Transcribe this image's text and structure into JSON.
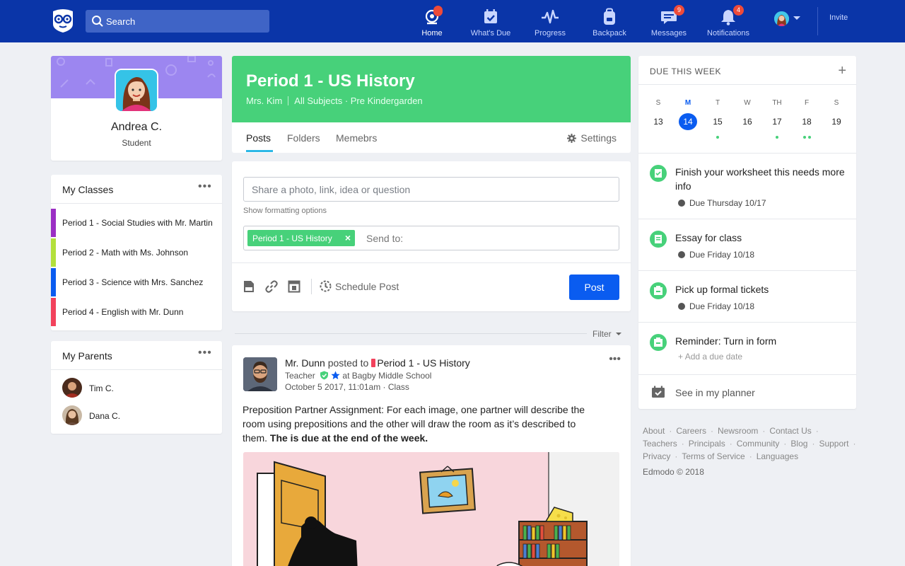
{
  "search": {
    "placeholder": "Search"
  },
  "nav": [
    {
      "label": "Home",
      "icon": "home-icon",
      "badge": ""
    },
    {
      "label": "What's Due",
      "icon": "calendar-check-icon",
      "badge": ""
    },
    {
      "label": "Progress",
      "icon": "pulse-icon",
      "badge": ""
    },
    {
      "label": "Backpack",
      "icon": "backpack-icon",
      "badge": ""
    },
    {
      "label": "Messages",
      "icon": "chat-icon",
      "badge": "9"
    },
    {
      "label": "Notifications",
      "icon": "bell-icon",
      "badge": "4"
    }
  ],
  "topbar": {
    "invite": "Invite"
  },
  "profile": {
    "name": "Andrea C.",
    "role": "Student"
  },
  "classes": {
    "title": "My Classes",
    "items": [
      {
        "label": "Period 1 - Social Studies with Mr. Martin",
        "color": "#9b2fc4"
      },
      {
        "label": "Period 2 - Math with Ms. Johnson",
        "color": "#b3e03c"
      },
      {
        "label": "Period 3 - Science with Mrs. Sanchez",
        "color": "#0a5cf0"
      },
      {
        "label": "Period 4 - English with Mr. Dunn",
        "color": "#f2425c"
      }
    ]
  },
  "parents": {
    "title": "My Parents",
    "items": [
      {
        "name": "Tim C."
      },
      {
        "name": "Dana C."
      }
    ]
  },
  "group": {
    "title": "Period 1 - US History",
    "teacher": "Mrs. Kim",
    "subjects": "All Subjects · Pre Kindergarden",
    "tabs": [
      "Posts",
      "Folders",
      "Memebrs"
    ],
    "settings": "Settings",
    "color": "#47d17a"
  },
  "composer": {
    "placeholder": "Share a photo, link, idea or question",
    "format_link": "Show formatting options",
    "chip": "Period 1 - US History",
    "send_to": "Send to:",
    "schedule": "Schedule Post",
    "post_button": "Post"
  },
  "filter": {
    "label": "Filter"
  },
  "post": {
    "author": "Mr. Dunn",
    "posted_to": "posted to",
    "group": "Period 1 - US History",
    "role": "Teacher",
    "school": "at Bagby Middle School",
    "timestamp": "October 5 2017, 11:01am · Class",
    "body": "Preposition Partner Assignment: For each image, one partner will describe the room using prepositions and the other will draw the room as it’s described to them.",
    "body_bold": "The is due at the end of the week."
  },
  "due_week": {
    "title": "DUE THIS WEEK",
    "days": [
      {
        "letter": "S",
        "num": "13",
        "dots": 0
      },
      {
        "letter": "M",
        "num": "14",
        "dots": 0,
        "today": true
      },
      {
        "letter": "T",
        "num": "15",
        "dots": 1
      },
      {
        "letter": "W",
        "num": "16",
        "dots": 0
      },
      {
        "letter": "TH",
        "num": "17",
        "dots": 1
      },
      {
        "letter": "F",
        "num": "18",
        "dots": 2
      },
      {
        "letter": "S",
        "num": "19",
        "dots": 0
      }
    ],
    "items": [
      {
        "name": "Finish your worksheet this needs more info",
        "date": "Due Thursday 10/17"
      },
      {
        "name": "Essay for class",
        "date": "Due Friday 10/18"
      },
      {
        "name": "Pick up formal tickets",
        "date": "Due Friday 10/18"
      },
      {
        "name": "Reminder: Turn in form",
        "add": "Add a due date"
      }
    ],
    "planner": "See in my planner"
  },
  "footer": {
    "links": [
      "About",
      "Careers",
      "Newsroom",
      "Contact Us",
      "Teachers",
      "Principals",
      "Community",
      "Blog",
      "Support",
      "Privacy",
      "Terms of Service",
      "Languages"
    ],
    "copyright": "Edmodo © 2018"
  }
}
